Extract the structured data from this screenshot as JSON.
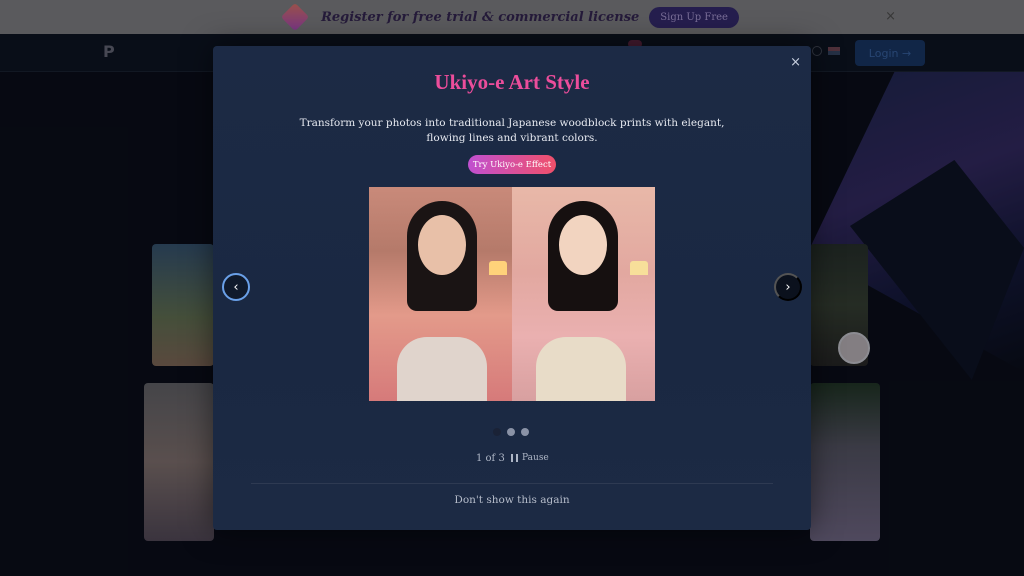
{
  "banner": {
    "text": "Register for free trial & commercial license",
    "button_label": "Sign Up Free",
    "close_label": "×"
  },
  "header": {
    "logo_text": "P",
    "login_label": "Login →"
  },
  "modal": {
    "close_label": "×",
    "title": "Ukiyo-e Art Style",
    "description": "Transform your photos into traditional Japanese woodblock prints with elegant, flowing lines and vibrant colors.",
    "try_button_label": "Try Ukiyo-e Effect",
    "prev_label": "‹",
    "next_label": "›",
    "slide_counter": "1 of 3",
    "pause_label": "Pause",
    "dont_show_label": "Don't show this again",
    "current_slide": 1,
    "total_slides": 3
  },
  "colors": {
    "title_pink": "#ec4d9b",
    "modal_bg": "#1c2a45",
    "try_button_gradient_start": "#c050d0",
    "try_button_gradient_end": "#f0506a"
  },
  "icons": [
    "banner-logo-icon",
    "close-icon",
    "globe-icon",
    "flag-icon",
    "chevron-left-icon",
    "chevron-right-icon",
    "pause-icon"
  ]
}
